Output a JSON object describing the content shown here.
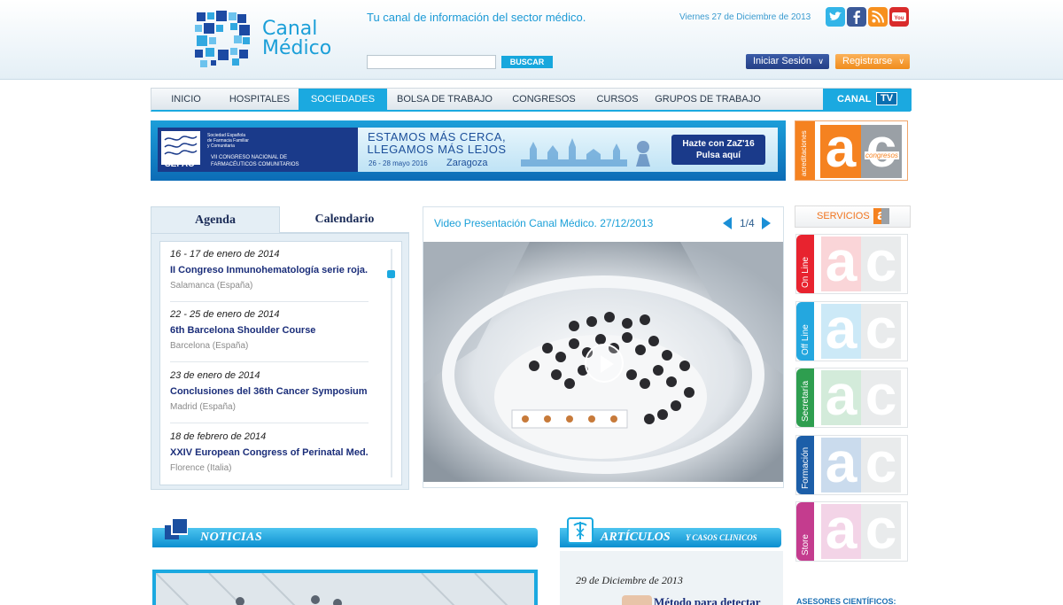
{
  "header": {
    "logo_line1": "Canal",
    "logo_line2": "Médico",
    "tagline": "Tu canal de información del sector médico.",
    "date": "Viernes 27 de Diciembre de 2013",
    "search_button": "BUSCAR",
    "login_button": "Iniciar Sesión",
    "register_button": "Registrarse",
    "social_icons": [
      "twitter-icon",
      "facebook-icon",
      "rss-icon",
      "youtube-icon"
    ]
  },
  "nav": {
    "items": [
      "INICIO",
      "HOSPITALES",
      "SOCIEDADES",
      "BOLSA DE TRABAJO",
      "CONGRESOS",
      "CURSOS",
      "GRUPOS DE TRABAJO"
    ],
    "active": "SOCIEDADES",
    "canal_label": "CANAL",
    "tv_label": "TV"
  },
  "banner": {
    "org": "SEFAC",
    "org_full": "Sociedad Española de Farmacia Familiar y Comunitaria",
    "congress": "VII CONGRESO NACIONAL DE FARMACÉUTICOS COMUNITARIOS",
    "headline1": "ESTAMOS MÁS CERCA,",
    "headline2": "LLEGAMOS MÁS LEJOS",
    "dates": "26 - 28 mayo 2016",
    "city": "Zaragoza",
    "cta1": "Hazte con ZaZ'16",
    "cta2": "Pulsa aquí"
  },
  "ac_congresos": {
    "side_label": "acreditaciones",
    "word": "congresos",
    "letter_a": "a",
    "letter_c": "c"
  },
  "agenda": {
    "tab_agenda": "Agenda",
    "tab_calendar": "Calendario",
    "events": [
      {
        "date": "16 - 17 de enero de 2014",
        "title": "II Congreso Inmunohematología serie roja.",
        "place": "Salamanca (España)"
      },
      {
        "date": "22 - 25 de enero de 2014",
        "title": "6th Barcelona Shoulder Course",
        "place": "Barcelona (España)"
      },
      {
        "date": "23 de enero de 2014",
        "title": "Conclusiones del 36th Cancer Symposium",
        "place": "Madrid (España)"
      },
      {
        "date": "18 de febrero de 2014",
        "title": "XXIV European Congress of Perinatal Med.",
        "place": "Florence (Italia)"
      }
    ]
  },
  "video": {
    "title": "Video Presentación Canal Médico. 27/12/2013",
    "counter": "1/4"
  },
  "servicios": {
    "label": "SERVICIOS",
    "items": [
      {
        "label": "On Line",
        "color": "#e8232f"
      },
      {
        "label": "Off Line",
        "color": "#24a7df"
      },
      {
        "label": "Secretaría",
        "color": "#2e9e4f"
      },
      {
        "label": "Formación",
        "color": "#1c5ea8"
      },
      {
        "label": "Store",
        "color": "#c43c8e"
      }
    ]
  },
  "noticias": {
    "title": "NOTICIAS"
  },
  "articulos": {
    "title": "ARTÍCULOS",
    "subtitle": "Y CASOS CLINICOS",
    "date": "29 de Diciembre de 2013",
    "first_link": "Método para detectar"
  },
  "asesores": "ASESORES CIENTÍFICOS:",
  "colors": {
    "accent": "#1ba9e0",
    "navy": "#1b2e7a",
    "orange": "#f58220"
  }
}
